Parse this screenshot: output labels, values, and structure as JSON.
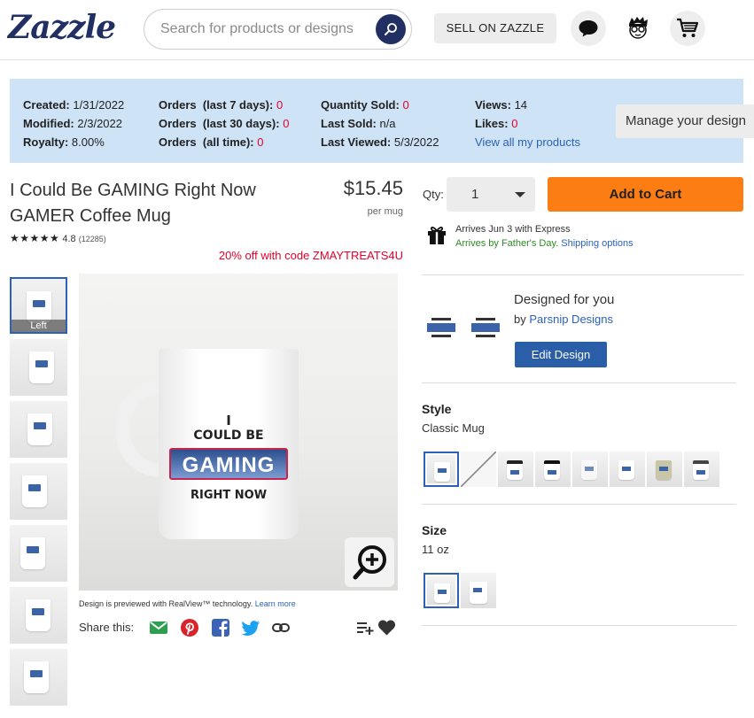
{
  "header": {
    "logo": "Zazzle",
    "search_placeholder": "Search for products or designs",
    "sell_label": "SELL ON ZAZZLE"
  },
  "seller_panel": {
    "created_label": "Created:",
    "created": "1/31/2022",
    "modified_label": "Modified:",
    "modified": "2/3/2022",
    "royalty_label": "Royalty:",
    "royalty": "8.00%",
    "orders7_label": "Orders  (last 7 days):",
    "orders7": "0",
    "orders30_label": "Orders  (last 30 days):",
    "orders30": "0",
    "orders_all_label": "Orders  (all time):",
    "orders_all": "0",
    "qty_sold_label": "Quantity Sold:",
    "qty_sold": "0",
    "last_sold_label": "Last Sold:",
    "last_sold": "n/a",
    "last_viewed_label": "Last Viewed:",
    "last_viewed": "5/3/2022",
    "views_label": "Views:",
    "views": "14",
    "likes_label": "Likes:",
    "likes": "0",
    "view_all": "View all my products",
    "manage": "Manage your design"
  },
  "product": {
    "title": "I Could Be GAMING Right Now GAMER Coffee Mug",
    "price": "$15.45",
    "per": "per mug",
    "stars": "★★★★★",
    "rating": "4.8",
    "review_count": "(12285)",
    "promo": "20% off with code ZMAYTREATS4U",
    "thumb_selected_label": "Left",
    "mug_line1": "I",
    "mug_line2": "COULD BE",
    "mug_line3": "GAMING",
    "mug_line4": "RIGHT NOW",
    "realview_text": "Design is previewed with RealView™ technology.",
    "realview_link": "Learn more",
    "share_label": "Share this:"
  },
  "purchase": {
    "qty_label": "Qty:",
    "qty_value": "1",
    "add_to_cart": "Add to Cart",
    "arrives": "Arrives Jun 3 with Express",
    "arrives_fathers": "Arrives by Father's Day.",
    "shipping_options": "Shipping options"
  },
  "design": {
    "title": "Designed for you",
    "by": "by",
    "designer": "Parsnip Designs",
    "edit": "Edit Design"
  },
  "style": {
    "heading": "Style",
    "value": "Classic Mug"
  },
  "size": {
    "heading": "Size",
    "value": "11 oz"
  },
  "colors": {
    "brand_navy": "#212f63",
    "link_blue": "#2b62b8",
    "cart_orange": "#fd7d15",
    "panel_blue": "#cfe3f6",
    "promo_red": "#e5002b"
  }
}
